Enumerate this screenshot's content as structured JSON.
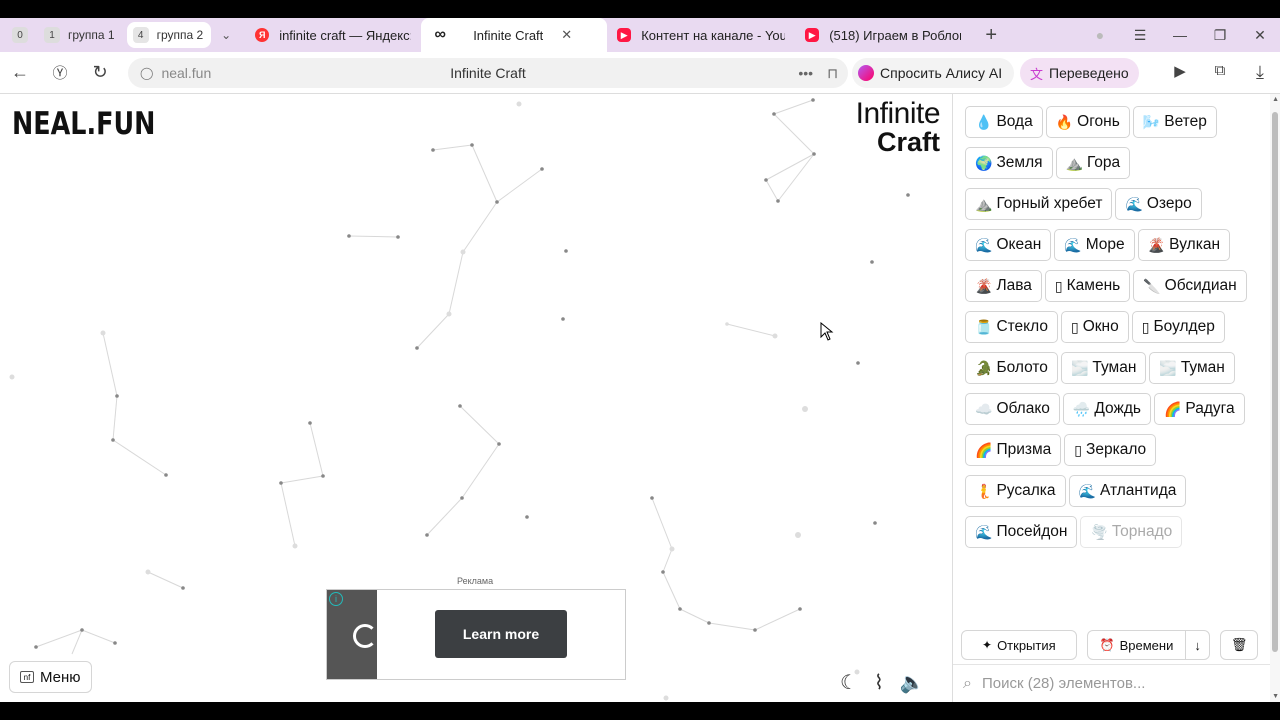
{
  "browser": {
    "tab_groups": [
      {
        "count": "0",
        "label": ""
      },
      {
        "count": "1",
        "label": "группа 1"
      },
      {
        "count": "4",
        "label": "группа 2"
      }
    ],
    "tabs": [
      {
        "title": "infinite craft — Яндекс: на",
        "favicon": "yandex-icon"
      },
      {
        "title": "Infinite Craft",
        "favicon": "infinity-icon",
        "active": true
      },
      {
        "title": "Контент на канале - YouTu",
        "favicon": "youtube-icon"
      },
      {
        "title": "(518) Играем в Роблокс к",
        "favicon": "youtube-icon"
      }
    ],
    "url": "neal.fun",
    "page_title": "Infinite Craft",
    "alice_label": "Спросить Алису AI",
    "translate_label": "Переведено"
  },
  "site": {
    "brand": "NEAL.FUN",
    "logo_line1": "Infinite",
    "logo_line2": "Craft",
    "ad_label": "Реклама",
    "ad_button": "Learn more",
    "menu_label": "Меню"
  },
  "sidebar": {
    "items": [
      {
        "emoji": "💧",
        "label": "Вода"
      },
      {
        "emoji": "🔥",
        "label": "Огонь"
      },
      {
        "emoji": "🌬️",
        "label": "Ветер"
      },
      {
        "emoji": "🌍",
        "label": "Земля"
      },
      {
        "emoji": "⛰️",
        "label": "Гора"
      },
      {
        "emoji": "⛰️",
        "label": "Горный хребет"
      },
      {
        "emoji": "🌊",
        "label": "Озеро"
      },
      {
        "emoji": "🌊",
        "label": "Океан"
      },
      {
        "emoji": "🌊",
        "label": "Море"
      },
      {
        "emoji": "🌋",
        "label": "Вулкан"
      },
      {
        "emoji": "🌋",
        "label": "Лава"
      },
      {
        "emoji": "▯",
        "label": "Камень"
      },
      {
        "emoji": "🔪",
        "label": "Обсидиан"
      },
      {
        "emoji": "🫙",
        "label": "Стекло"
      },
      {
        "emoji": "▯",
        "label": "Окно"
      },
      {
        "emoji": "▯",
        "label": "Боулдер"
      },
      {
        "emoji": "🐊",
        "label": "Болото"
      },
      {
        "emoji": "🌫️",
        "label": "Туман"
      },
      {
        "emoji": "🌫️",
        "label": "Туман"
      },
      {
        "emoji": "☁️",
        "label": "Облако"
      },
      {
        "emoji": "🌧️",
        "label": "Дождь"
      },
      {
        "emoji": "🌈",
        "label": "Радуга"
      },
      {
        "emoji": "🌈",
        "label": "Призма"
      },
      {
        "emoji": "▯",
        "label": "Зеркало"
      },
      {
        "emoji": "🧜",
        "label": "Русалка"
      },
      {
        "emoji": "🌊",
        "label": "Атлантида"
      },
      {
        "emoji": "🌊",
        "label": "Посейдон"
      },
      {
        "emoji": "🌪️",
        "label": "Торнадо",
        "faded": true
      }
    ],
    "sort_discoveries": "Открытия",
    "sort_time": "Времени",
    "search_placeholder": "Поиск (28) элементов..."
  },
  "colors": {
    "tabbar_bg": "#e9daf1",
    "translate_bg": "#f3e1f4",
    "ad_button_bg": "#3c3f42"
  }
}
